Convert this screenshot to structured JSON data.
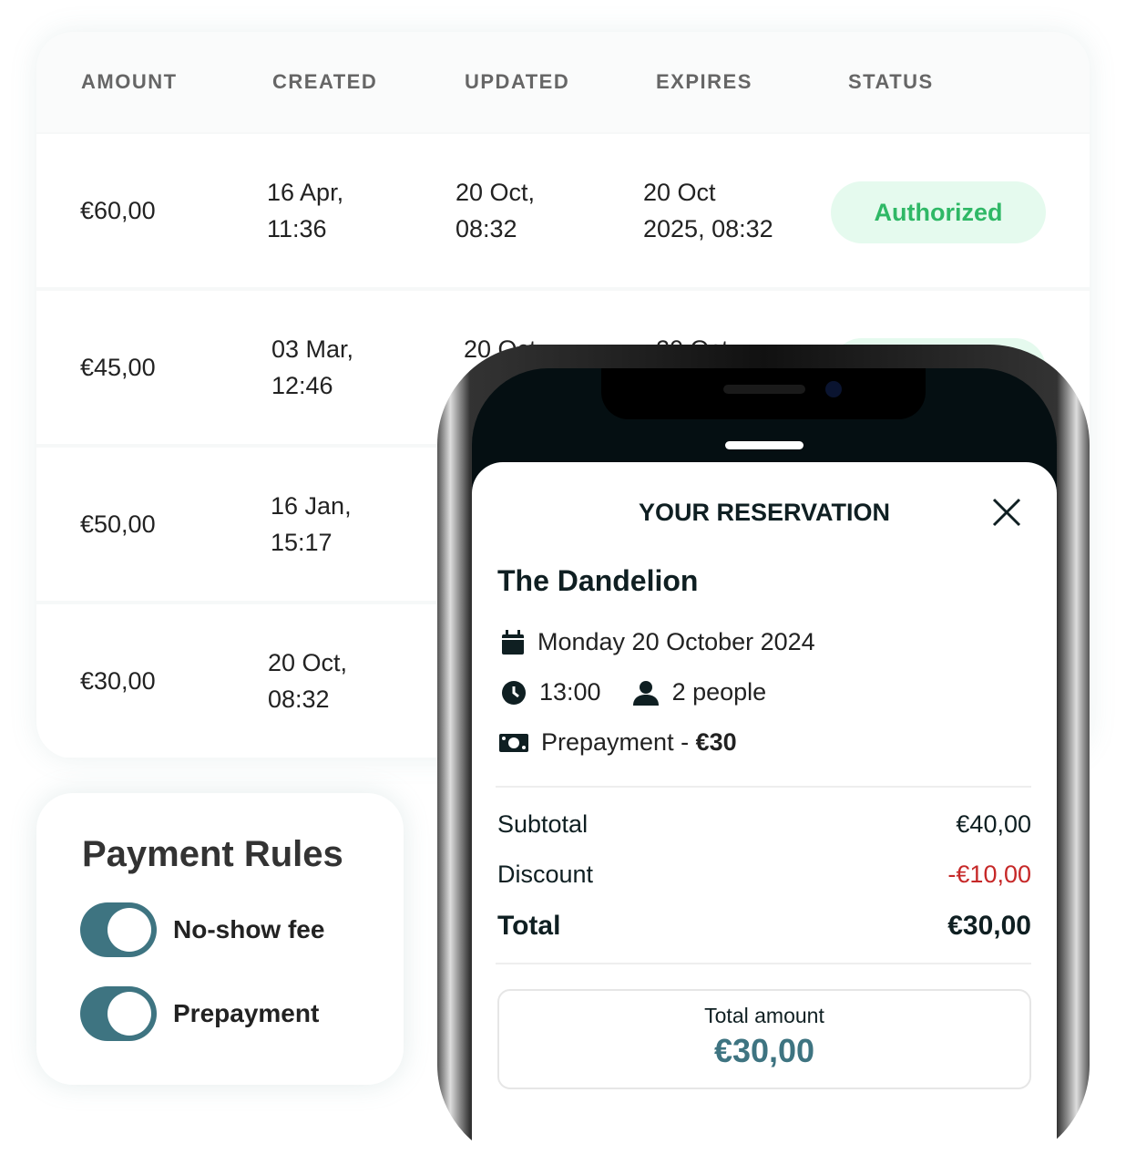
{
  "table": {
    "headers": [
      "AMOUNT",
      "CREATED",
      "UPDATED",
      "EXPIRES",
      "STATUS"
    ],
    "rows": [
      {
        "amount": "€60,00",
        "created": "16 Apr,\n11:36",
        "updated": "20 Oct,\n08:32",
        "expires": "20 Oct\n2025, 08:32",
        "status": "Authorized"
      },
      {
        "amount": "€45,00",
        "created": "03 Mar,\n12:46",
        "updated": "20 Oct,",
        "expires": "20 Oct",
        "status": ""
      },
      {
        "amount": "€50,00",
        "created": "16 Jan,\n15:17",
        "updated": "",
        "expires": "",
        "status": ""
      },
      {
        "amount": "€30,00",
        "created": "20 Oct,\n08:32",
        "updated": "",
        "expires": "",
        "status": ""
      }
    ]
  },
  "rules": {
    "title": "Payment Rules",
    "toggles": [
      {
        "label": "No-show fee",
        "on": true
      },
      {
        "label": "Prepayment",
        "on": true
      }
    ]
  },
  "reservation": {
    "title": "YOUR RESERVATION",
    "restaurant": "The Dandelion",
    "date": "Monday 20 October 2024",
    "time": "13:00",
    "people": "2 people",
    "prepay_label": "Prepayment - ",
    "prepay_amount": "€30",
    "subtotal_label": "Subtotal",
    "subtotal": "€40,00",
    "discount_label": "Discount",
    "discount": "-€10,00",
    "total_label": "Total",
    "total": "€30,00",
    "total_amount_label": "Total amount",
    "total_amount": "€30,00"
  },
  "colors": {
    "accent": "#3e7481",
    "status_green": "#2fb866",
    "discount_red": "#c62828"
  }
}
